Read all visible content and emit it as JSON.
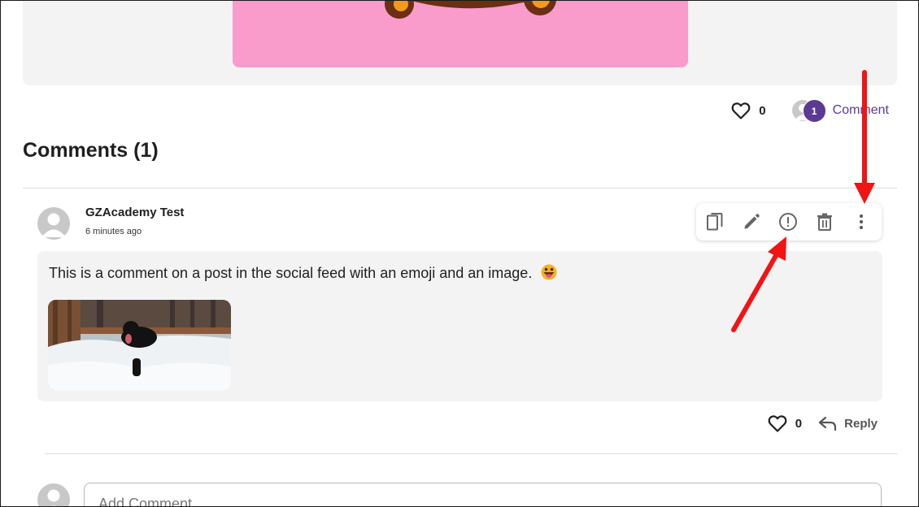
{
  "post": {
    "like_count": "0",
    "comment_count": "1",
    "comment_link_label": "Comment"
  },
  "comments_section": {
    "heading": "Comments (1)"
  },
  "comment": {
    "author": "GZAcademy Test",
    "timestamp": "6 minutes ago",
    "text": "This is a comment on a post in the social feed with an emoji and an image.",
    "emoji": "grinning-face-with-tongue-emoji",
    "image_alt": "black dog playing in snow",
    "like_count": "0",
    "reply_label": "Reply",
    "toolbar_icons": [
      "copy-icon",
      "pencil-icon",
      "report-icon",
      "trash-icon",
      "more-vertical-icon"
    ]
  },
  "add_comment": {
    "placeholder": "Add Comment"
  },
  "colors": {
    "accent_purple": "#5a3a93",
    "pink_image": "#f99bcb",
    "annotation_red": "#f01414",
    "card_bg": "#f3f3f3"
  }
}
